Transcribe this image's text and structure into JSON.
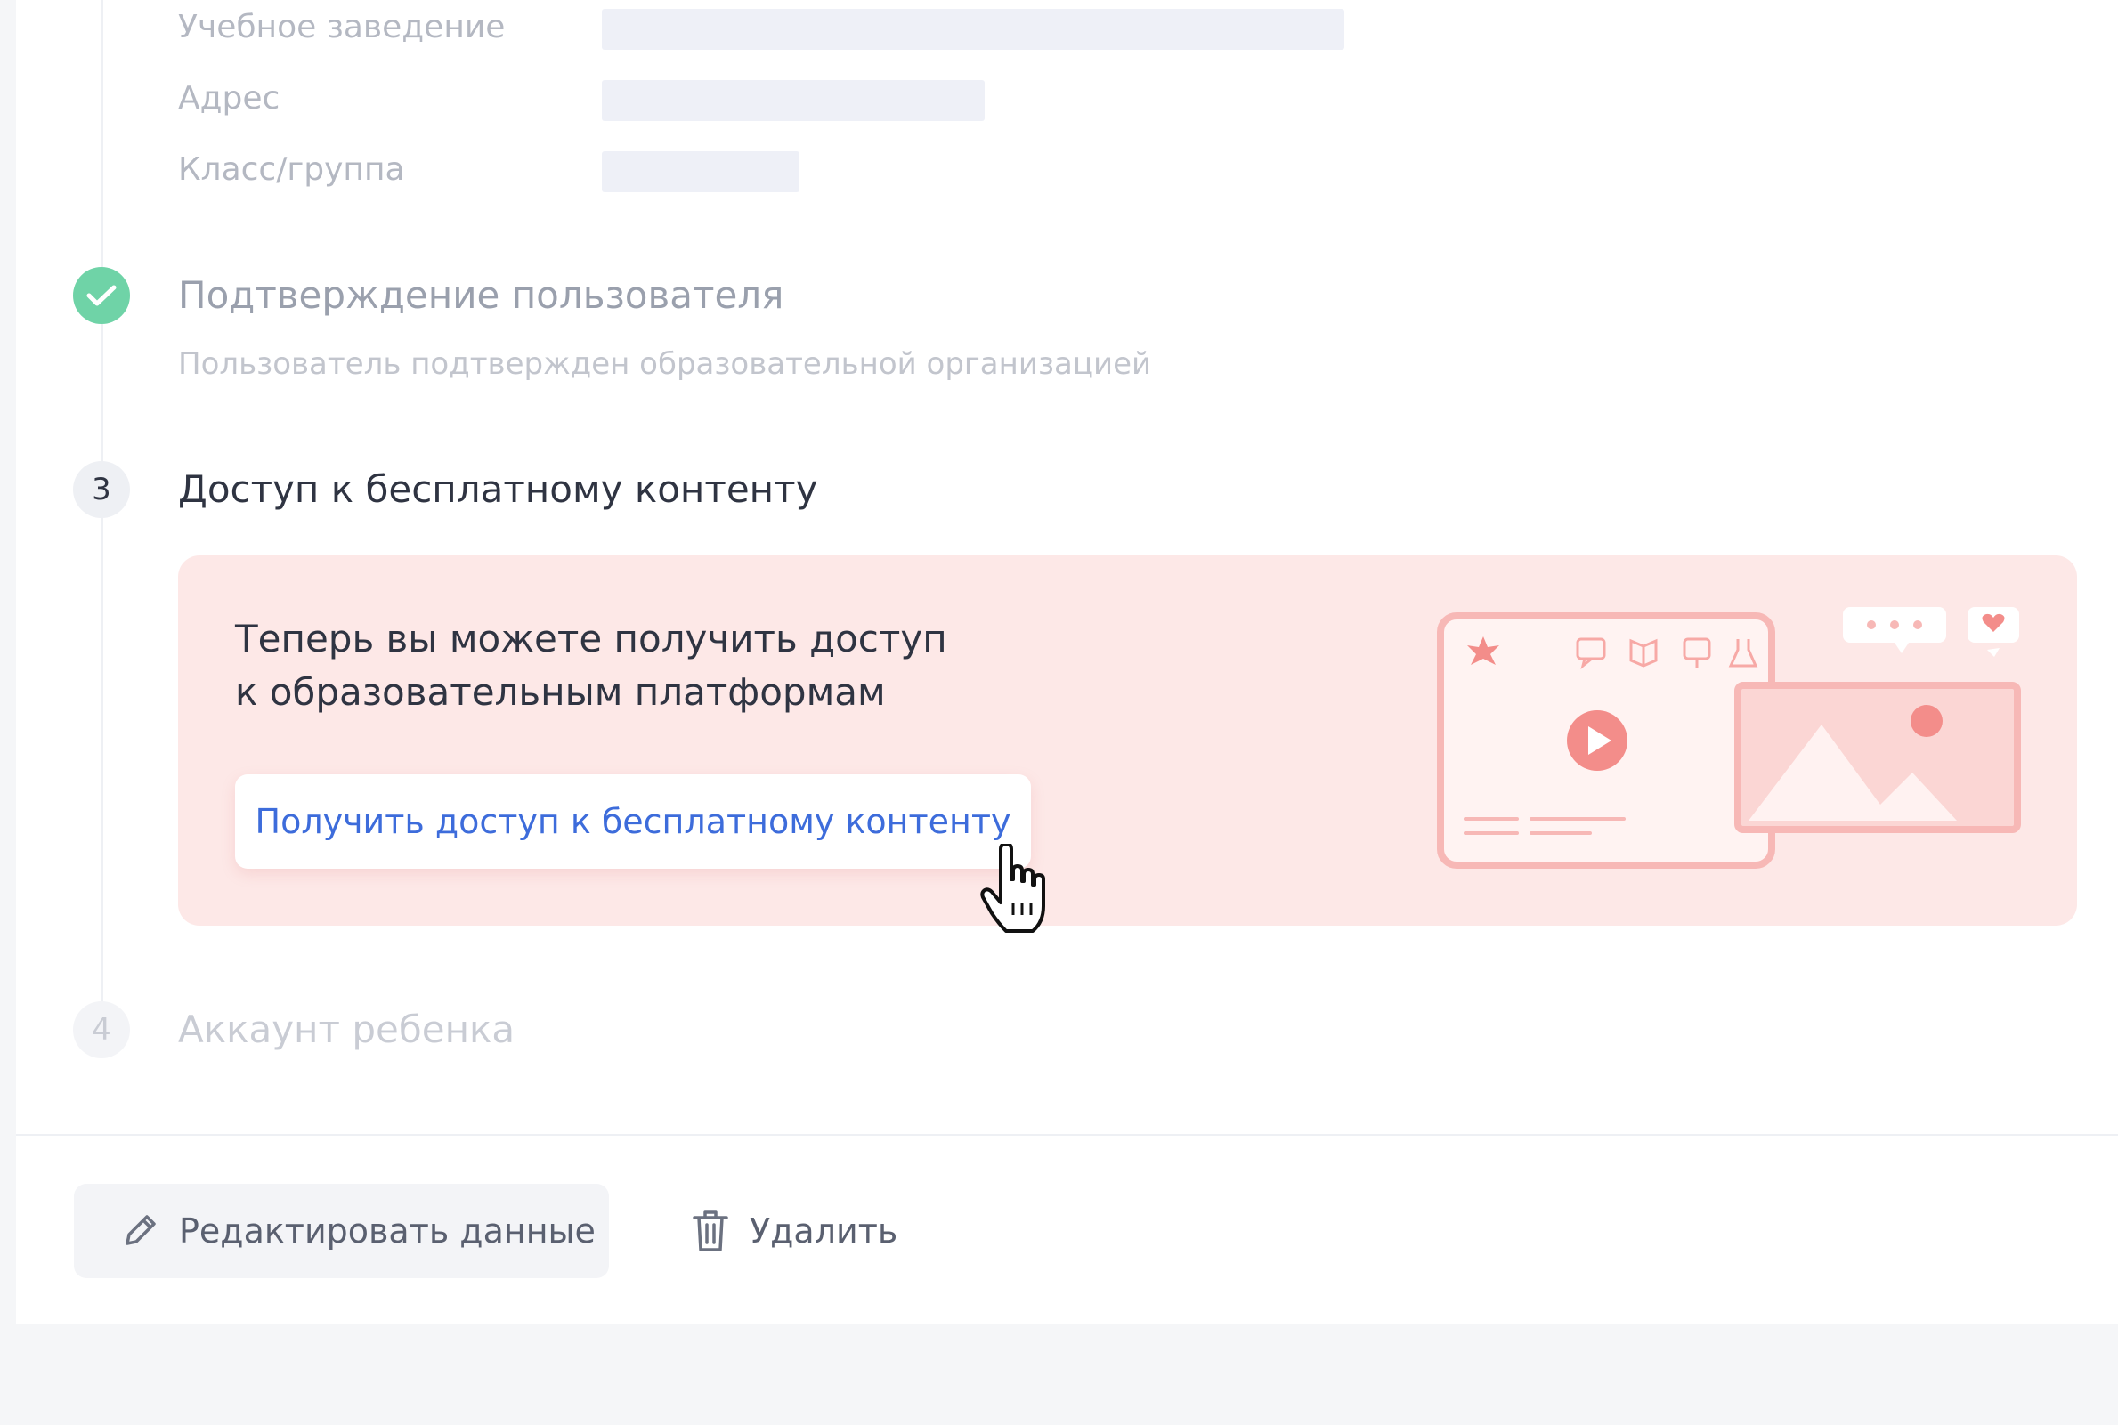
{
  "info_rows": [
    {
      "label": "Учебное заведение"
    },
    {
      "label": "Адрес"
    },
    {
      "label": "Класс/группа"
    }
  ],
  "steps": {
    "confirmation": {
      "title": "Подтверждение пользователя",
      "subtitle": "Пользователь подтвержден образовательной организацией",
      "icon": "check-icon"
    },
    "free_content": {
      "number": "3",
      "title": "Доступ к бесплатному контенту"
    },
    "child_account": {
      "number": "4",
      "title": "Аккаунт ребенка"
    }
  },
  "promo": {
    "line1": "Теперь вы можете получить доступ",
    "line2": "к образовательным платформам",
    "button_label": "Получить доступ к бесплатному контенту",
    "illustration": "video-player-illustration"
  },
  "actions": {
    "edit_label": "Редактировать данные",
    "edit_icon": "pencil-icon",
    "delete_label": "Удалить",
    "delete_icon": "trash-icon"
  },
  "colors": {
    "accent": "#3d6cdb",
    "success": "#6fd3a7",
    "promo_bg": "#fde8e7",
    "illustration": "#f38d8a"
  }
}
